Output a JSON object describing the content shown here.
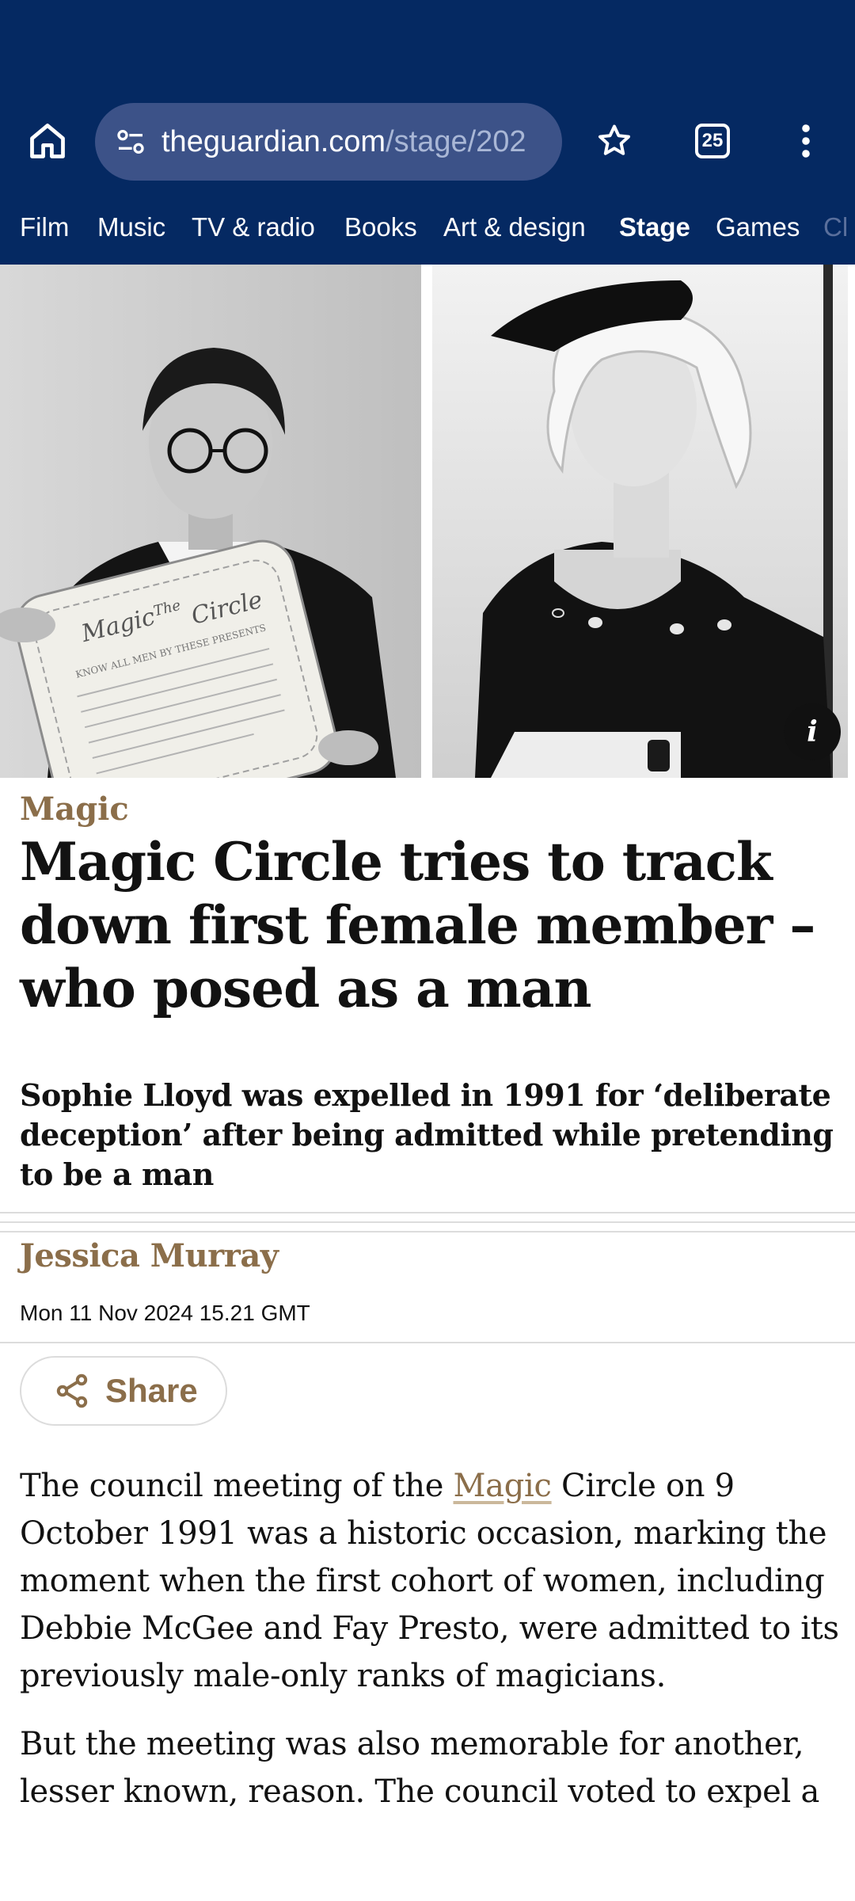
{
  "browser": {
    "url_domain": "theguardian.com",
    "url_path": "/stage/202",
    "tab_count": "25",
    "icons": {
      "home": "home-icon",
      "site_settings": "site-settings-icon",
      "bookmark": "star-outline-icon",
      "tabs": "tab-switcher-icon",
      "menu": "more-vert-icon"
    },
    "colors": {
      "chrome": "#052962",
      "address_bar": "#3c5288"
    }
  },
  "section_nav": {
    "items": [
      {
        "label": "Film"
      },
      {
        "label": "Music"
      },
      {
        "label": "TV & radio"
      },
      {
        "label": "Books"
      },
      {
        "label": "Art & design"
      },
      {
        "label": "Stage",
        "active": true
      },
      {
        "label": "Games"
      },
      {
        "label": "Cl"
      }
    ]
  },
  "hero": {
    "info_label": "i",
    "certificate_text": [
      "Magic",
      "The",
      "Circle",
      "KNOW ALL MEN BY THESE PRESENTS"
    ]
  },
  "article": {
    "kicker": "Magic",
    "headline": "Magic Circle tries to track down first female member – who posed as a man",
    "standfirst": "Sophie Lloyd was expelled in 1991 for ‘deliberate deception’ after being admitted while pretending to be a man",
    "byline": "Jessica Murray",
    "dateline": "Mon 11 Nov 2024 15.21 GMT",
    "share_label": "Share",
    "para1": {
      "before": "The council meeting of the ",
      "link": "Magic",
      "after": " Circle on 9 October 1991 was a historic occasion, marking the moment when the first cohort of women, including Debbie McGee and Fay Presto, were admitted to its previously male-only ranks of magicians."
    },
    "para2": "But the meeting was also memorable for another, lesser known, reason. The council voted to expel a",
    "colors": {
      "accent": "#8b6e4a",
      "text": "#121212"
    }
  }
}
